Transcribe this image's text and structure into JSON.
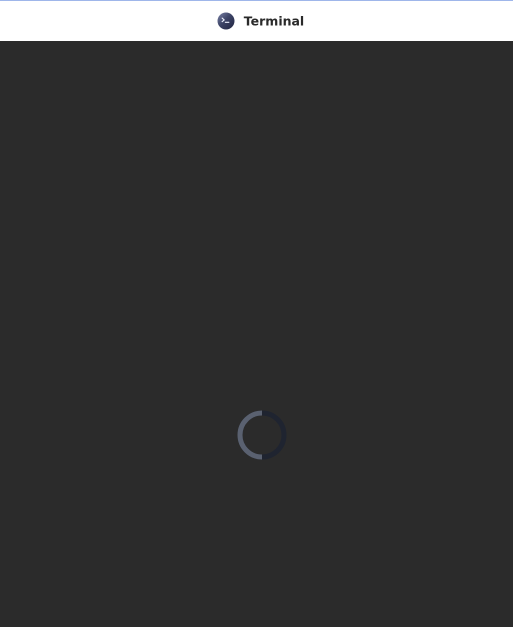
{
  "window": {
    "title": "Terminal"
  },
  "icons": {
    "app": "terminal-icon",
    "loading": "loading-spinner-icon"
  },
  "colors": {
    "titlebar_background": "#ffffff",
    "titlebar_border": "#9fb6ea",
    "title_text": "#2a2a2a",
    "content_background": "#2b2b2b",
    "spinner_track": "#1f2430",
    "spinner_arc": "#5a6170"
  }
}
